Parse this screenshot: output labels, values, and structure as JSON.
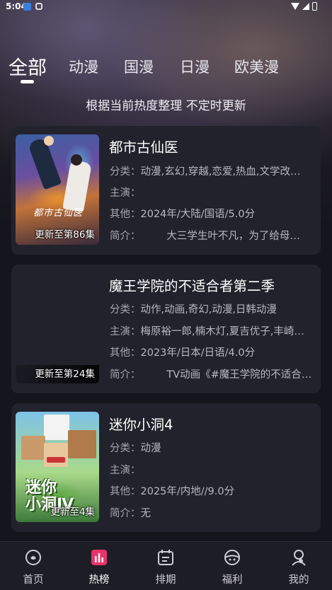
{
  "status_bar": {
    "time": "5:04"
  },
  "tabs": [
    {
      "label": "全部",
      "active": true
    },
    {
      "label": "动漫",
      "active": false
    },
    {
      "label": "国漫",
      "active": false
    },
    {
      "label": "日漫",
      "active": false
    },
    {
      "label": "欧美漫",
      "active": false
    }
  ],
  "subtitle": "根据当前热度整理 不定时更新",
  "labels": {
    "category": "分类：",
    "cast": "主演：",
    "other": "其他：",
    "intro": "简介："
  },
  "items": [
    {
      "title": "都市古仙医",
      "badge": "更新至第86集",
      "poster_text": "都市古仙医",
      "category": "动漫,玄幻,穿越,恋爱,热血,文学改…",
      "cast": "",
      "other": "2024年/大陆/国语/5.0分",
      "intro": "        大三学生叶不凡，为了给母…"
    },
    {
      "title": "魔王学院的不适合者第二季",
      "badge": "更新至第24集",
      "category": "动作,动画,奇幻,动漫,日韩动漫",
      "cast": "梅原裕一郎,楠木灯,夏吉优子,丰崎…",
      "other": "2023年/日本/日语/4.0分",
      "intro": "        TV动画《#魔王学院的不适合…"
    },
    {
      "title": "迷你小洞4",
      "badge": "更新至4集",
      "poster_text": "迷你\n小洞Ⅳ",
      "category": "动漫",
      "cast": "",
      "other": "2025年/内地//9.0分",
      "intro": "无"
    }
  ],
  "bottom_nav": [
    {
      "label": "首页",
      "icon": "home-icon",
      "active": false
    },
    {
      "label": "热榜",
      "icon": "hot-list-icon",
      "active": true
    },
    {
      "label": "排期",
      "icon": "schedule-icon",
      "active": false
    },
    {
      "label": "福利",
      "icon": "gift-icon",
      "active": false
    },
    {
      "label": "我的",
      "icon": "profile-icon",
      "active": false
    }
  ],
  "colors": {
    "background": "#15151d",
    "card": "#22222c",
    "active_nav": "#e8336a",
    "text_secondary": "#b9b8c2"
  }
}
